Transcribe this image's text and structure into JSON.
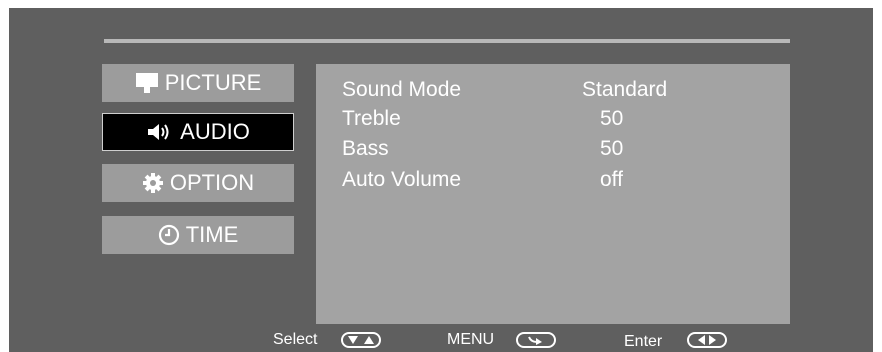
{
  "menu": {
    "items": [
      {
        "label": "PICTURE",
        "icon": "monitor-icon",
        "active": false
      },
      {
        "label": "AUDIO",
        "icon": "speaker-icon",
        "active": true
      },
      {
        "label": "OPTION",
        "icon": "gear-icon",
        "active": false
      },
      {
        "label": "TIME",
        "icon": "clock-icon",
        "active": false
      }
    ]
  },
  "audio_settings": {
    "rows": [
      {
        "label": "Sound Mode",
        "value": "Standard"
      },
      {
        "label": "Treble",
        "value": "50"
      },
      {
        "label": "Bass",
        "value": "50"
      },
      {
        "label": "Auto Volume",
        "value": "off"
      }
    ]
  },
  "footer": {
    "select_label": "Select",
    "select_icon": "up-down-arrows-icon",
    "menu_label": "MENU",
    "menu_icon": "return-arrow-icon",
    "enter_label": "Enter",
    "enter_icon": "left-right-arrows-icon"
  },
  "colors": {
    "background": "#5f5f5f",
    "menu_item": "#9c9c9c",
    "menu_item_active": "#000000",
    "panel": "#a3a3a3",
    "text": "#ffffff"
  }
}
